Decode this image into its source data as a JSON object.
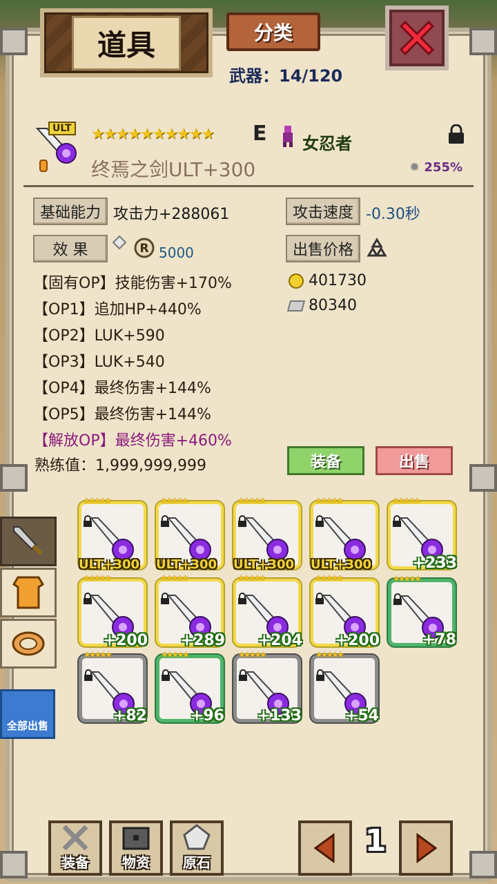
{
  "window": {
    "title": "道具",
    "category_button": "分类",
    "weapon_count": "武器：14/120"
  },
  "item": {
    "tag": "ULT",
    "stars": "★★★★★★★★★★",
    "grade": "E",
    "class_name": "女忍者",
    "name": "终焉之剑ULT+300",
    "percent": "255%"
  },
  "stats": {
    "base_label": "基础能力",
    "base_value": "攻击力+288061",
    "speed_label": "攻击速度",
    "speed_value": "-0.30秒",
    "effect_label": "效 果",
    "effect_value": "5000",
    "sell_label": "出售价格",
    "gold_price": "401730",
    "stone_price": "80340"
  },
  "options": [
    {
      "text": "【固有OP】技能伤害+170%"
    },
    {
      "text": "【OP1】追加HP+440%"
    },
    {
      "text": "【OP2】LUK+590"
    },
    {
      "text": "【OP3】LUK+540"
    },
    {
      "text": "【OP4】最终伤害+144%"
    },
    {
      "text": "【OP5】最终伤害+144%"
    },
    {
      "text": "【解放OP】最终伤害+460%"
    }
  ],
  "proficiency": "熟练值：1,999,999,999",
  "actions": {
    "equip": "装备",
    "sell": "出售",
    "sell_all": "全部出售"
  },
  "inventory": [
    {
      "label": "ULT+300",
      "frame": "yellow",
      "kind": "ult"
    },
    {
      "label": "ULT+300",
      "frame": "yellow",
      "kind": "ult"
    },
    {
      "label": "ULT+300",
      "frame": "yellow",
      "kind": "ult"
    },
    {
      "label": "ULT+300",
      "frame": "yellow",
      "kind": "ult"
    },
    {
      "label": "+233",
      "frame": "yellow",
      "kind": "lvl"
    },
    {
      "label": "+200",
      "frame": "yellow",
      "kind": "lvl"
    },
    {
      "label": "+289",
      "frame": "yellow",
      "kind": "lvl"
    },
    {
      "label": "+204",
      "frame": "yellow",
      "kind": "lvl"
    },
    {
      "label": "+200",
      "frame": "yellow",
      "kind": "lvl"
    },
    {
      "label": "+78",
      "frame": "green",
      "kind": "lvl"
    },
    {
      "label": "+82",
      "frame": "gray",
      "kind": "lvl"
    },
    {
      "label": "+96",
      "frame": "green",
      "kind": "lvl"
    },
    {
      "label": "+133",
      "frame": "gray",
      "kind": "lvl"
    },
    {
      "label": "+54",
      "frame": "gray",
      "kind": "lvl"
    }
  ],
  "bottom_nav": {
    "equip": "装备",
    "materials": "物资",
    "ore": "原石"
  },
  "pagination": {
    "page": "1"
  },
  "colors": {
    "panel": "#efe4c9",
    "equip_btn": "#8fd36a",
    "sell_btn": "#f09a9a",
    "close_btn": "#e63040"
  }
}
